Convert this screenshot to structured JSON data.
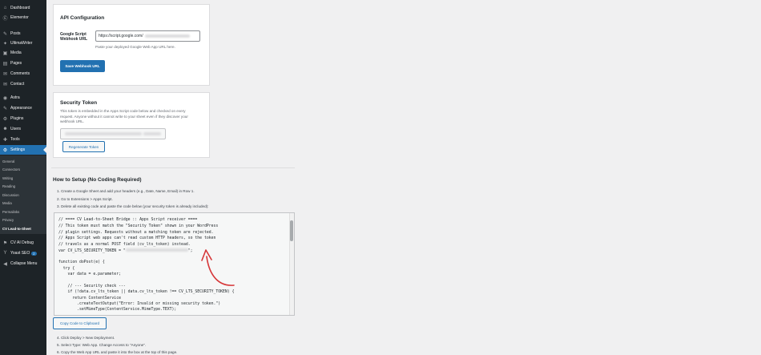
{
  "sidebar": {
    "items": [
      {
        "label": "Dashboard",
        "icon": "dashboard-icon",
        "glyph": "⌂"
      },
      {
        "label": "Elementor",
        "icon": "elementor-icon",
        "glyph": "Ⓔ"
      },
      {
        "label": "Posts",
        "icon": "pin-icon",
        "glyph": "✎"
      },
      {
        "label": "UltimaWriter",
        "icon": "ultimawriter-icon",
        "glyph": "✦"
      },
      {
        "label": "Media",
        "icon": "media-icon",
        "glyph": "▣"
      },
      {
        "label": "Pages",
        "icon": "pages-icon",
        "glyph": "▤"
      },
      {
        "label": "Comments",
        "icon": "comments-icon",
        "glyph": "✉"
      },
      {
        "label": "Contact",
        "icon": "contact-icon",
        "glyph": "✉"
      },
      {
        "label": "Astra",
        "icon": "astra-icon",
        "glyph": "◉"
      },
      {
        "label": "Appearance",
        "icon": "appearance-icon",
        "glyph": "✎"
      },
      {
        "label": "Plugins",
        "icon": "plugins-icon",
        "glyph": "⚙"
      },
      {
        "label": "Users",
        "icon": "users-icon",
        "glyph": "☻"
      },
      {
        "label": "Tools",
        "icon": "tools-icon",
        "glyph": "✚"
      },
      {
        "label": "Settings",
        "icon": "settings-icon",
        "glyph": "⚙"
      }
    ],
    "submenu": [
      "General",
      "Connectors",
      "Writing",
      "Reading",
      "Discussion",
      "Media",
      "Permalinks",
      "Privacy",
      "CV Lead-to-Sheet"
    ],
    "bottom_items": [
      {
        "label": "CV AI Debug",
        "icon": "debug-icon",
        "glyph": "⚑"
      },
      {
        "label": "Yoast SEO",
        "icon": "yoast-icon",
        "glyph": "Y",
        "badge": "2"
      },
      {
        "label": "Collapse Menu",
        "icon": "collapse-icon",
        "glyph": "◀"
      }
    ]
  },
  "api_config": {
    "title": "API Configuration",
    "url_label_line1": "Google Script",
    "url_label_line2": "Webhook URL",
    "url_value": "https://script.google.com/",
    "url_help": "Paste your deployed Google Web App URL here.",
    "save_button": "Save Webhook URL"
  },
  "security": {
    "title": "Security Token",
    "desc_line1": "This token is embedded in the Apps Script code below and checked on every",
    "desc_line2": "request. Anyone without it cannot write to your sheet even if they discover your",
    "desc_line3": "webhook URL.",
    "regenerate_button": "Regenerate Token"
  },
  "setup": {
    "title": "How to Setup (No Coding Required)",
    "steps_top": [
      "1. Create a Google Sheet and add your headers (e.g., Date, Name, Email) in Row 1.",
      "2. Go to Extensions > Apps Script.",
      "3. Delete all existing code and paste the code below (your security token is already included):"
    ],
    "code_lines": [
      "// ==== CV Lead-to-Sheet Bridge :: Apps Script receiver ====",
      "// This token must match the \"Security Token\" shown in your WordPress",
      "// plugin settings. Requests without a matching token are rejected.",
      "// Apps Script web apps can't read custom HTTP headers, so the token",
      "// travels as a normal POST field (cv_lts_token) instead.",
      "var CV_LTS_SECURITY_TOKEN = \"",
      "",
      "function doPost(e) {",
      "  try {",
      "    var data = e.parameter;",
      "",
      "    // --- Security check ---",
      "    if (!data.cv_lts_token || data.cv_lts_token !== CV_LTS_SECURITY_TOKEN) {",
      "      return ContentService",
      "        .createTextOutput(\"Error: Invalid or missing security token.\")",
      "        .setMimeType(ContentService.MimeType.TEXT);"
    ],
    "code_token_end": "\";",
    "copy_button": "Copy Code to Clipboard",
    "steps_bottom": [
      "4. Click Deploy > New Deployment.",
      "5. Select Type: Web App. Change Access to \"Anyone\".",
      "6. Copy the Web App URL and paste it into the box at the top of this page."
    ]
  },
  "colors": {
    "accent": "#2271b1",
    "sidebar": "#1d2327",
    "arrow": "#d63638"
  }
}
